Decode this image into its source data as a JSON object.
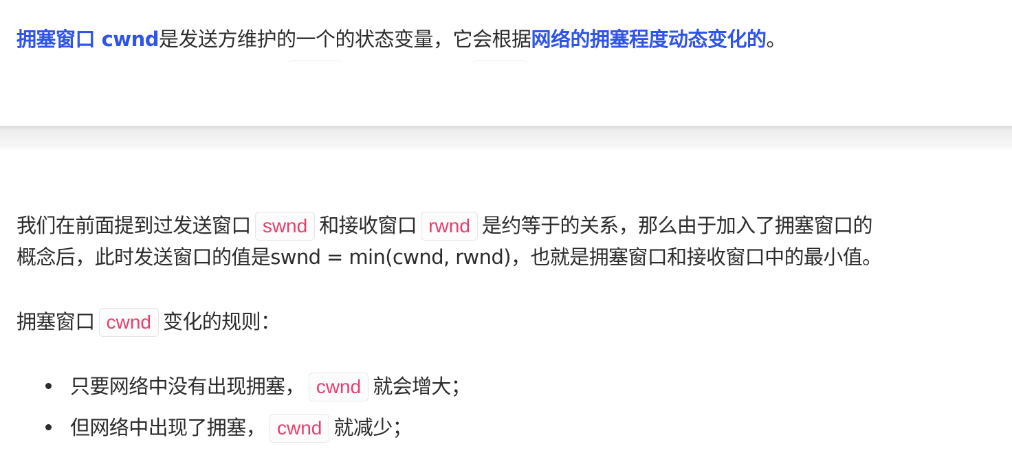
{
  "top": {
    "hl1": "拥塞窗口 cwnd",
    "text1": "是发送方维护的一个的状态变量，它会根据",
    "hl2": "网络的拥塞程度动态变化的",
    "end": "。"
  },
  "para1": {
    "t1": "我们在前面提到过发送窗口",
    "code1": "swnd",
    "t2": "和接收窗口",
    "code2": "rwnd",
    "t3": "是约等于的关系，那么由于加入了拥塞窗口的",
    "t4": "概念后，此时发送窗口的值是swnd = min(cwnd, rwnd)，也就是拥塞窗口和接收窗口中的最小值。"
  },
  "para2": {
    "t1": "拥塞窗口",
    "code": "cwnd",
    "t2": "变化的规则："
  },
  "list": [
    {
      "t1": "只要网络中没有出现拥塞，",
      "code": "cwnd",
      "t2": "就会增大；"
    },
    {
      "t1": "但网络中出现了拥塞，",
      "code": "cwnd",
      "t2": "就减少；"
    }
  ]
}
